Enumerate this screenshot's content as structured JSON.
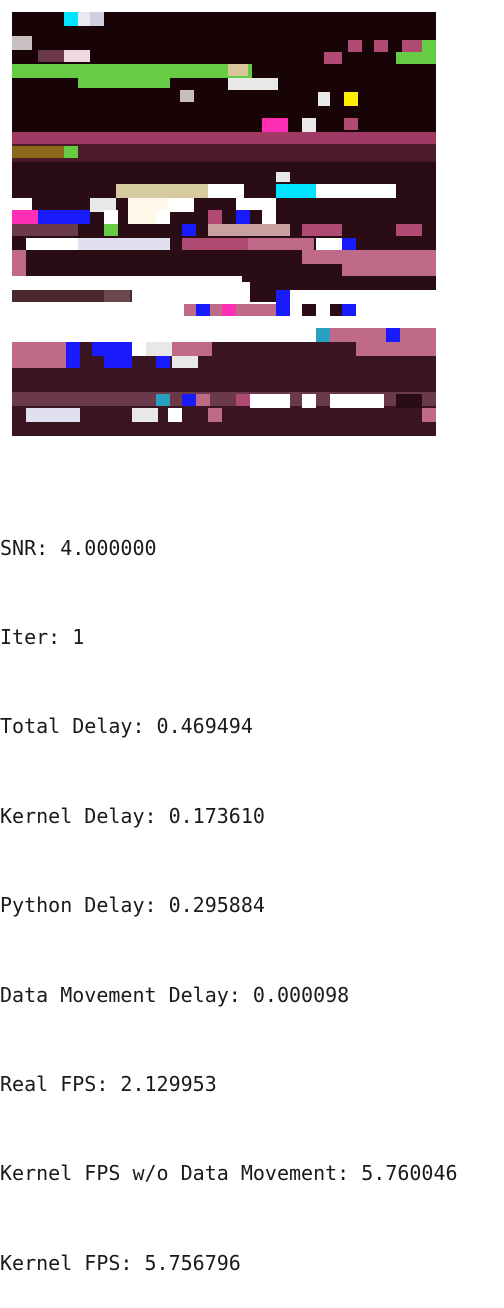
{
  "image": {
    "description_icon": "pixelated-image"
  },
  "stats": [
    "SNR: 4.000000",
    "Iter: 1",
    "Total Delay: 0.469494",
    "Kernel Delay: 0.173610",
    "Python Delay: 0.295884",
    "Data Movement Delay: 0.000098",
    "Real FPS: 2.129953",
    "Kernel FPS w/o Data Movement: 5.760046",
    "Kernel FPS: 5.756796"
  ]
}
